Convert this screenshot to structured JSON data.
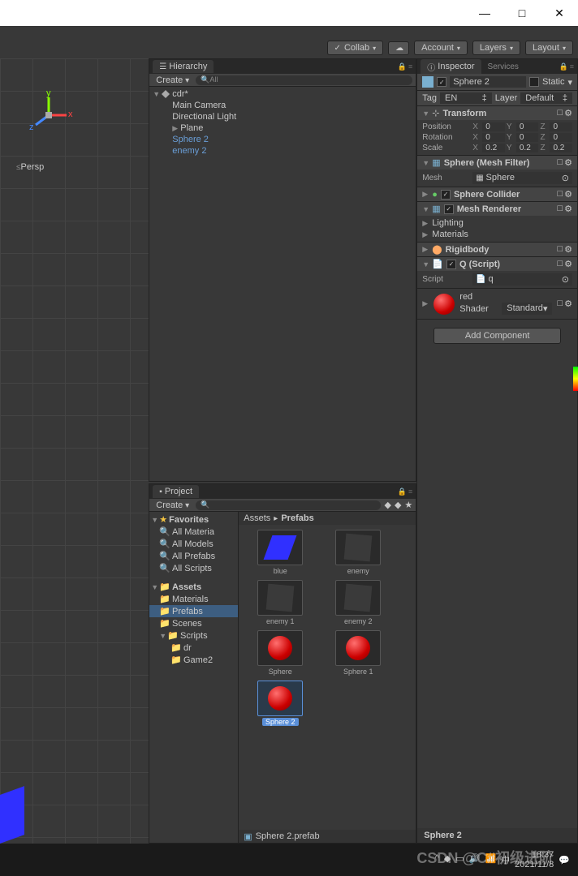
{
  "window": {
    "min": "—",
    "max": "□",
    "close": "✕"
  },
  "toolbar": {
    "collab": "Collab",
    "account": "Account",
    "layers": "Layers",
    "layout": "Layout"
  },
  "hierarchy": {
    "title": "Hierarchy",
    "create": "Create",
    "search_ph": "All",
    "scene": "cdr*",
    "items": [
      "Main Camera",
      "Directional Light",
      "Plane",
      "Sphere 2",
      "enemy 2"
    ]
  },
  "scene": {
    "persp": "Persp"
  },
  "project": {
    "title": "Project",
    "create": "Create",
    "favorites": "Favorites",
    "fav_items": [
      "All Materia",
      "All Models",
      "All Prefabs",
      "All Scripts"
    ],
    "assets": "Assets",
    "folders": [
      "Materials",
      "Prefabs",
      "Scenes",
      "Scripts"
    ],
    "sub_scripts": [
      "dr",
      "Game2"
    ],
    "breadcrumb": [
      "Assets",
      "Prefabs"
    ],
    "grid": [
      "blue",
      "enemy",
      "enemy 1",
      "enemy 2",
      "Sphere",
      "Sphere 1",
      "Sphere 2"
    ],
    "status_file": "Sphere 2.prefab"
  },
  "inspector": {
    "title": "Inspector",
    "services": "Services",
    "name": "Sphere 2",
    "static": "Static",
    "tag_label": "Tag",
    "tag_value": "EN",
    "layer_label": "Layer",
    "layer_value": "Default",
    "transform": {
      "title": "Transform",
      "pos_label": "Position",
      "rot_label": "Rotation",
      "scale_label": "Scale",
      "pos": {
        "x": "0",
        "y": "0",
        "z": "0"
      },
      "rot": {
        "x": "0",
        "y": "0",
        "z": "0"
      },
      "scale": {
        "x": "0.2",
        "y": "0.2",
        "z": "0.2"
      }
    },
    "meshfilter": {
      "title": "Sphere (Mesh Filter)",
      "mesh_label": "Mesh",
      "mesh_value": "Sphere"
    },
    "collider": {
      "title": "Sphere Collider"
    },
    "renderer": {
      "title": "Mesh Renderer",
      "lighting": "Lighting",
      "materials": "Materials"
    },
    "rigidbody": {
      "title": "Rigidbody"
    },
    "script": {
      "title": "Q (Script)",
      "label": "Script",
      "value": "q"
    },
    "material": {
      "name": "red",
      "shader_label": "Shader",
      "shader_value": "Standard"
    },
    "add_component": "Add Component",
    "status": "Sphere 2"
  },
  "taskbar": {
    "time": "18:37",
    "date": "2021/11/8",
    "watermark": "CSDN @C#初级进阶"
  }
}
